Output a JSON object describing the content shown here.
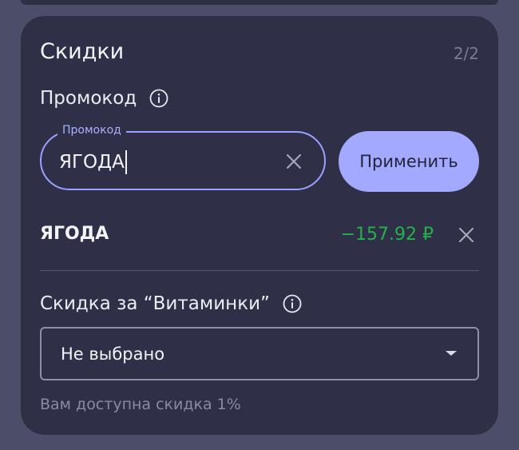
{
  "discounts": {
    "title": "Скидки",
    "counter": "2/2",
    "promo_section_label": "Промокод",
    "promo_field": {
      "floating_label": "Промокод",
      "value": "ЯГОДА"
    },
    "apply_button_label": "Применить",
    "applied_promo": {
      "code": "ЯГОДА",
      "amount": "−157.92 ₽"
    },
    "vitamins_section_label": "Скидка за “Витаминки”",
    "vitamins_select": {
      "value": "Не выбрано"
    },
    "hint_text": "Вам доступна скидка 1%"
  },
  "colors": {
    "background": "#4b4d69",
    "card": "#2f3047",
    "accent": "#a3a9ff",
    "discount": "#25b24d",
    "muted_text": "#898ba2"
  },
  "icons": {
    "info": "info-circle-icon",
    "clear": "close-icon",
    "remove": "close-icon",
    "dropdown": "caret-down-icon"
  }
}
